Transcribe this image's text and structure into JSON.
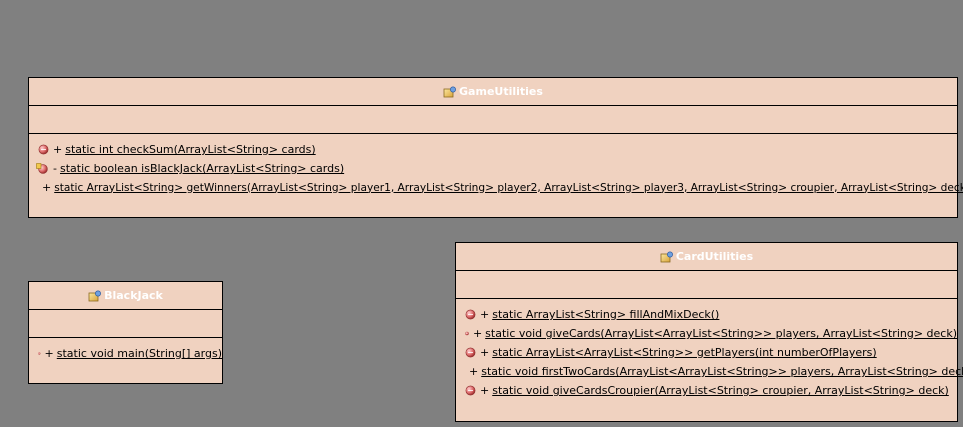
{
  "classes": {
    "game_utilities": {
      "name": "GameUtilities",
      "methods": [
        {
          "visibility": "+",
          "signature": "static int checkSum(ArrayList<String> cards)",
          "icon": "public-method-icon"
        },
        {
          "visibility": "-",
          "signature": "static boolean isBlackJack(ArrayList<String> cards)",
          "icon": "private-method-icon"
        },
        {
          "visibility": "+",
          "signature": "static ArrayList<String> getWinners(ArrayList<String> player1, ArrayList<String> player2, ArrayList<String> player3, ArrayList<String> croupier, ArrayList<String> deck)",
          "icon": "public-method-icon"
        }
      ]
    },
    "black_jack": {
      "name": "BlackJack",
      "methods": [
        {
          "visibility": "+",
          "signature": "static void main(String[] args)",
          "icon": "public-method-icon"
        }
      ]
    },
    "card_utilities": {
      "name": "CardUtilities",
      "methods": [
        {
          "visibility": "+",
          "signature": "static ArrayList<String> fillAndMixDeck()",
          "icon": "public-method-icon"
        },
        {
          "visibility": "+",
          "signature": "static void giveCards(ArrayList<ArrayList<String>> players, ArrayList<String> deck)",
          "icon": "public-method-icon"
        },
        {
          "visibility": "+",
          "signature": "static ArrayList<ArrayList<String>> getPlayers(int numberOfPlayers)",
          "icon": "public-method-icon"
        },
        {
          "visibility": "+",
          "signature": "static void firstTwoCards(ArrayList<ArrayList<String>> players, ArrayList<String> deck)",
          "icon": "public-method-icon"
        },
        {
          "visibility": "+",
          "signature": "static void giveCardsCroupier(ArrayList<String> croupier, ArrayList<String> deck)",
          "icon": "public-method-icon"
        }
      ]
    }
  },
  "colors": {
    "background": "#808080",
    "class_fill": "#f0d2c0",
    "class_border": "#000000",
    "class_name": "#ffffff",
    "method_icon": "#e07878"
  }
}
